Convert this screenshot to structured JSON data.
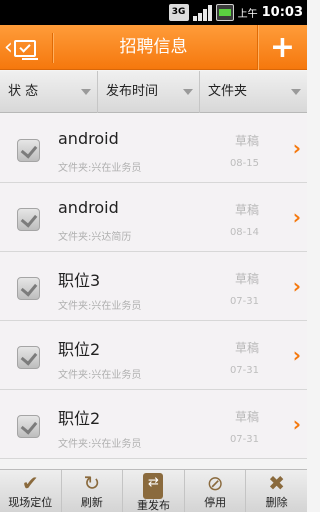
{
  "status_bar": {
    "network": "3G",
    "ampm": "上午",
    "time": "10:03"
  },
  "header": {
    "title": "招聘信息",
    "add_label": "+"
  },
  "filters": [
    {
      "label": "状 态"
    },
    {
      "label": "发布时间"
    },
    {
      "label": "文件夹"
    }
  ],
  "items": [
    {
      "title": "android",
      "folder": "文件夹:兴在业务员",
      "status": "草稿",
      "date": "08-15",
      "checked": true
    },
    {
      "title": "android",
      "folder": "文件夹:兴达简历",
      "status": "草稿",
      "date": "08-14",
      "checked": true
    },
    {
      "title": "职位3",
      "folder": "文件夹:兴在业务员",
      "status": "草稿",
      "date": "07-31",
      "checked": true
    },
    {
      "title": "职位2",
      "folder": "文件夹:兴在业务员",
      "status": "草稿",
      "date": "07-31",
      "checked": true
    },
    {
      "title": "职位2",
      "folder": "文件夹:兴在业务员",
      "status": "草稿",
      "date": "07-31",
      "checked": true
    }
  ],
  "toolbar": [
    {
      "label": "现场定位",
      "icon": "check-icon"
    },
    {
      "label": "刷新",
      "icon": "refresh-icon"
    },
    {
      "label": "重发布",
      "icon": "republish-icon"
    },
    {
      "label": "停用",
      "icon": "disable-icon"
    },
    {
      "label": "删除",
      "icon": "delete-icon"
    }
  ],
  "colors": {
    "accent": "#f5780d",
    "toolbar_icon": "#8a6a3d"
  }
}
